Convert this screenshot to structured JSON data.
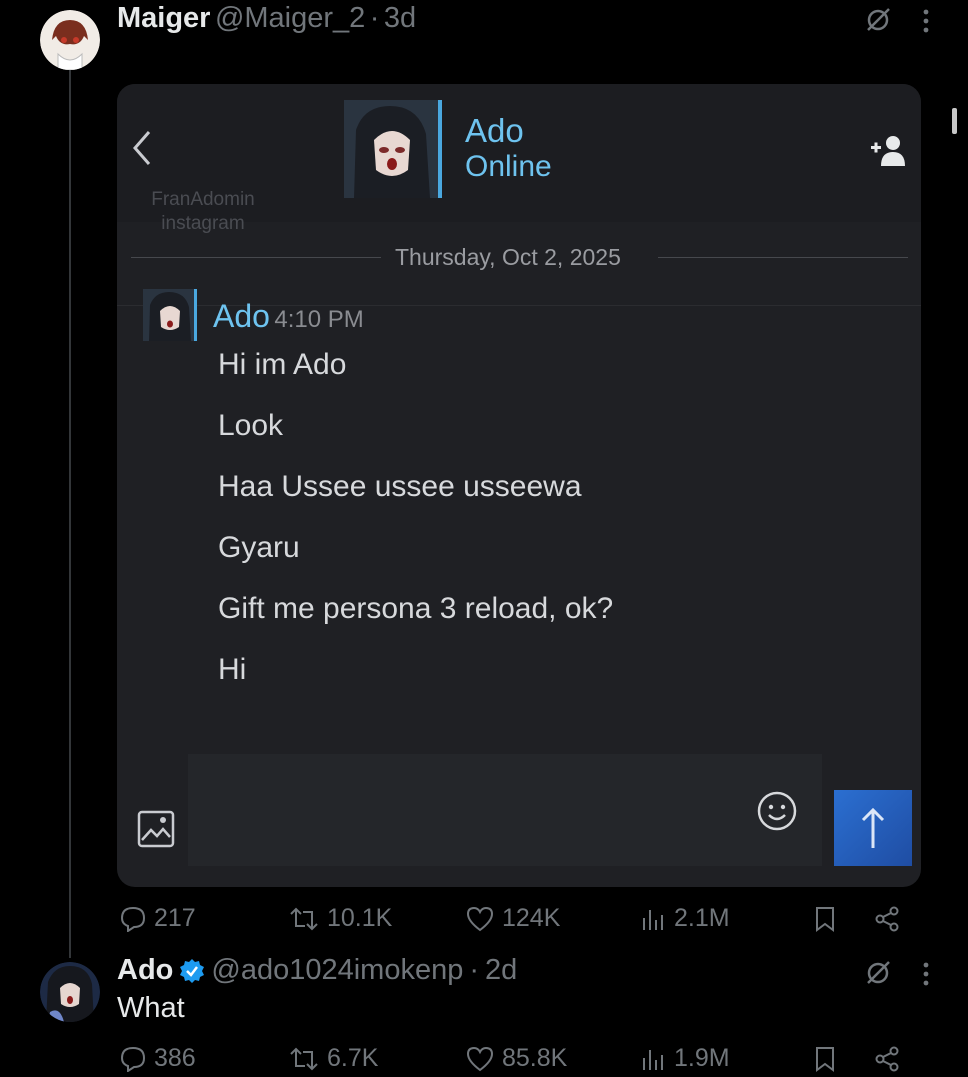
{
  "tweet1": {
    "name": "Maiger",
    "handle": "@Maiger_2",
    "time": "3d",
    "image": {
      "chat_title": "Ado",
      "chat_status": "Online",
      "watermark_line1": "FranAdomin",
      "watermark_line2": "instagram",
      "date": "Thursday, Oct 2, 2025",
      "sender": "Ado",
      "sender_time": "4:10 PM",
      "messages": [
        "Hi im Ado",
        "Look",
        "Haa Ussee ussee usseewa",
        "Gyaru",
        "Gift me persona 3 reload, ok?",
        "Hi"
      ]
    },
    "stats": {
      "replies": "217",
      "reposts": "10.1K",
      "likes": "124K",
      "views": "2.1M"
    }
  },
  "tweet2": {
    "name": "Ado",
    "handle": "@ado1024imokenp",
    "time": "2d",
    "text": "What",
    "stats": {
      "replies": "386",
      "reposts": "6.7K",
      "likes": "85.8K",
      "views": "1.9M"
    }
  },
  "colors": {
    "background": "#000000",
    "text": "#e7e9ea",
    "muted": "#71767b",
    "verified": "#1d9bf0",
    "chat_accent": "#6ec3ef"
  }
}
